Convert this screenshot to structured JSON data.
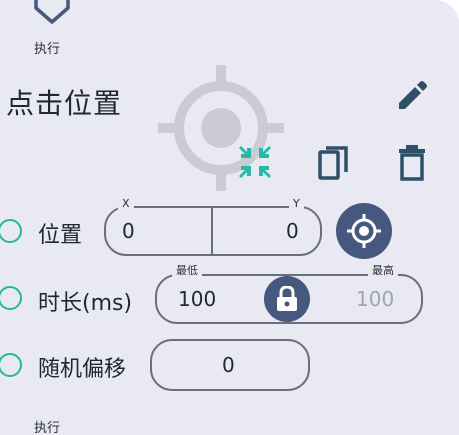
{
  "header": {
    "action_label": "执行",
    "title": "点击位置"
  },
  "position_row": {
    "label": "位置",
    "x_label": "X",
    "y_label": "Y",
    "x_value": "0",
    "y_value": "0"
  },
  "duration_row": {
    "label": "时长(ms)",
    "min_label": "最低",
    "max_label": "最高",
    "min_value": "100",
    "max_value": "100"
  },
  "offset_row": {
    "label": "随机偏移",
    "value": "0"
  },
  "footer": {
    "action_label": "执行"
  },
  "colors": {
    "panel_background": "#e9e9f3",
    "accent_blue": "#46587e",
    "radio_green": "#25b98e",
    "icon_teal": "#2f4f67"
  },
  "icons": {
    "top": "shield-icon",
    "edit": "pencil-icon",
    "collapse": "collapse-arrows-icon",
    "copy": "copy-icon",
    "delete": "trash-icon",
    "target": "crosshair-target-icon",
    "lock": "lock-icon"
  }
}
